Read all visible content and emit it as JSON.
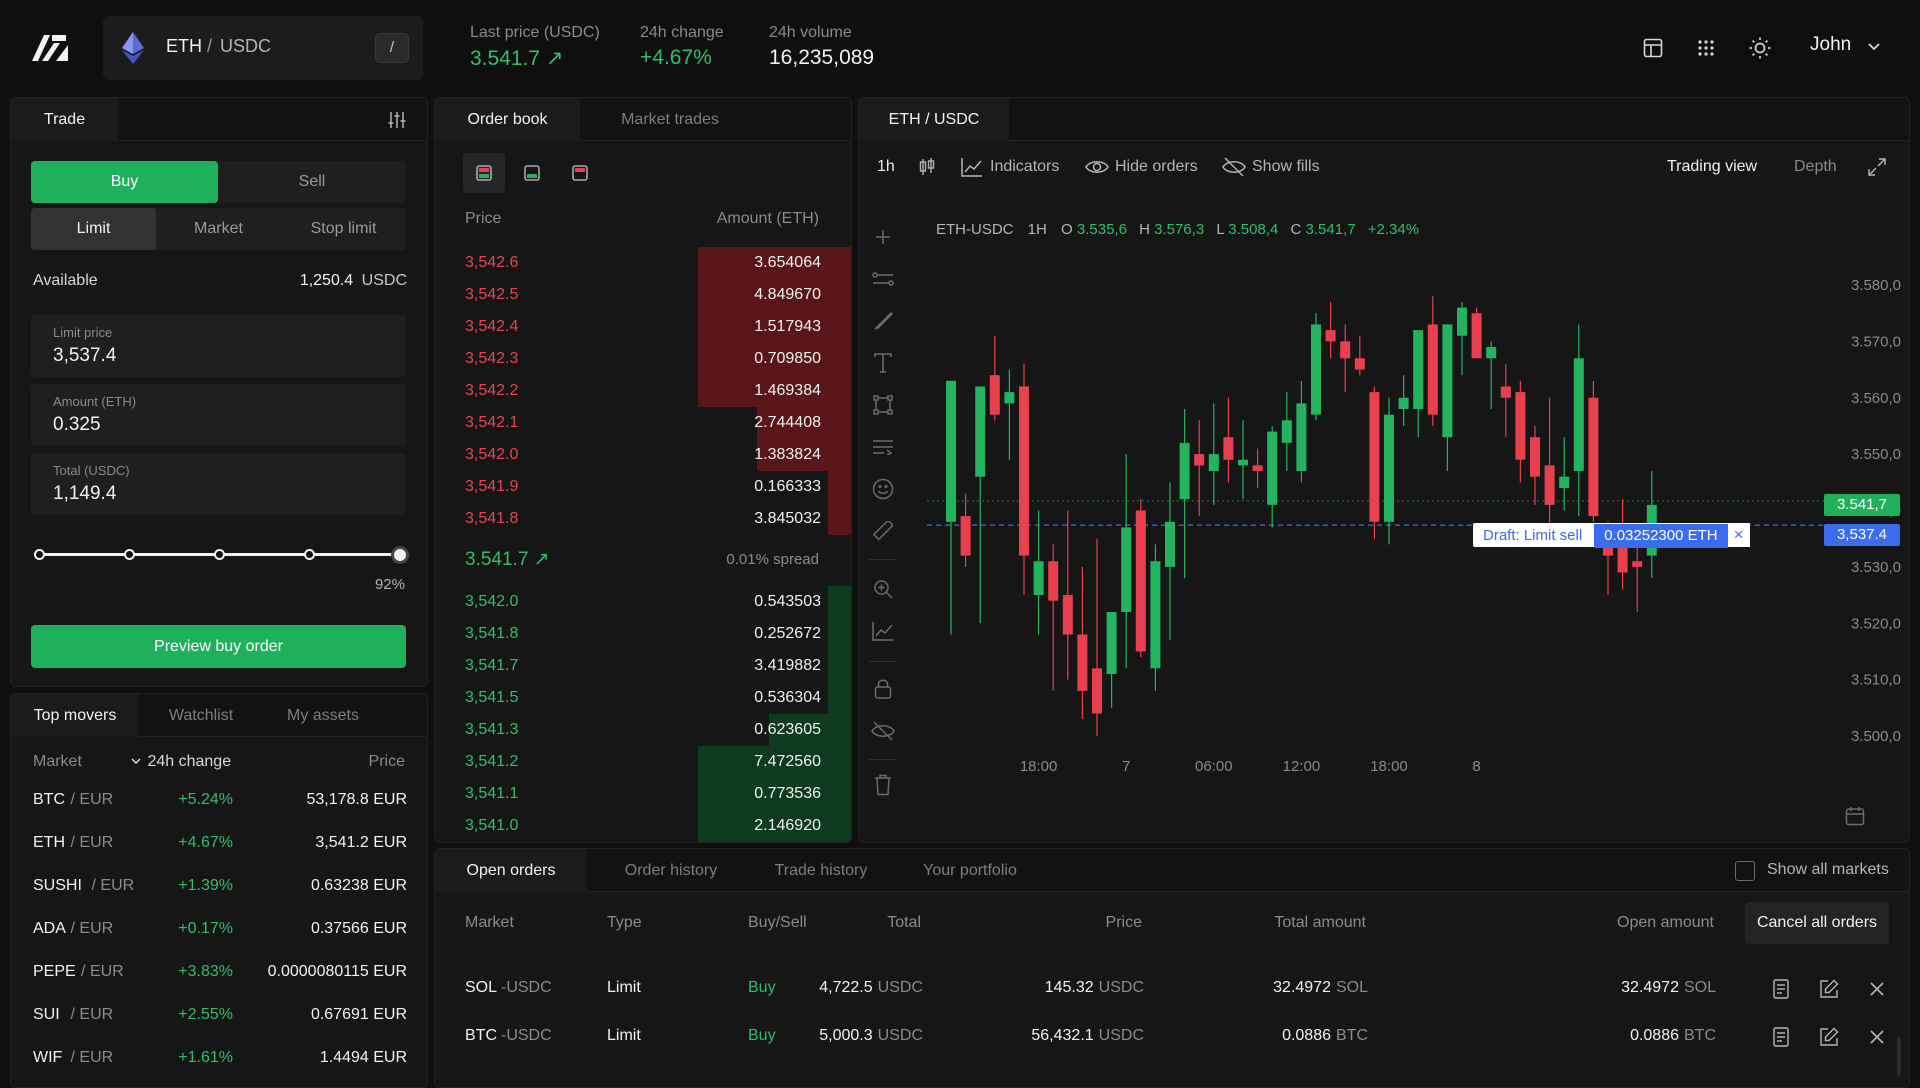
{
  "header": {
    "pair_base": "ETH",
    "pair_sep": "/",
    "pair_quote": "USDC",
    "search_key": "/",
    "stats": [
      {
        "label": "Last price (USDC)",
        "value": "3.541.7 ↗"
      },
      {
        "label": "24h change",
        "value": "+4.67%"
      },
      {
        "label": "24h volume",
        "value": "16,235,089"
      }
    ],
    "user": "John"
  },
  "trade": {
    "tab": "Trade",
    "buy": "Buy",
    "sell": "Sell",
    "order_types": [
      "Limit",
      "Market",
      "Stop limit"
    ],
    "available_label": "Available",
    "available_value": "1,250.4",
    "available_unit": "USDC",
    "limit_price_label": "Limit price",
    "limit_price": "3,537.4",
    "amount_label": "Amount (ETH)",
    "amount": "0.325",
    "total_label": "Total (USDC)",
    "total": "1,149.4",
    "slider_fraction": 0.92,
    "slider_text": "92%",
    "preview_button": "Preview buy order"
  },
  "movers": {
    "tabs": [
      "Top movers",
      "Watchlist",
      "My assets"
    ],
    "col_market": "Market",
    "col_change": "24h change",
    "col_price": "Price",
    "rows": [
      {
        "base": "BTC",
        "quote": "/ EUR",
        "change": "+5.24%",
        "price": "53,178.8 EUR"
      },
      {
        "base": "ETH",
        "quote": "/ EUR",
        "change": "+4.67%",
        "price": "3,541.2 EUR"
      },
      {
        "base": "SUSHI",
        "quote": "/ EUR",
        "change": "+1.39%",
        "price": "0.63238 EUR"
      },
      {
        "base": "ADA",
        "quote": "/ EUR",
        "change": "+0.17%",
        "price": "0.37566 EUR"
      },
      {
        "base": "PEPE",
        "quote": "/ EUR",
        "change": "+3.83%",
        "price": "0.0000080115 EUR"
      },
      {
        "base": "SUI",
        "quote": "/ EUR",
        "change": "+2.55%",
        "price": "0.67691 EUR"
      },
      {
        "base": "WIF",
        "quote": "/ EUR",
        "change": "+1.61%",
        "price": "1.4494 EUR"
      }
    ]
  },
  "orderbook": {
    "tabs": [
      "Order book",
      "Market trades"
    ],
    "col_price": "Price",
    "col_amount": "Amount (ETH)",
    "asks": [
      {
        "price": "3,542.6",
        "amount": "3.654064",
        "depth": 0.37
      },
      {
        "price": "3,542.5",
        "amount": "4.849670",
        "depth": 0.37
      },
      {
        "price": "3,542.4",
        "amount": "1.517943",
        "depth": 0.37
      },
      {
        "price": "3,542.3",
        "amount": "0.709850",
        "depth": 0.37
      },
      {
        "price": "3,542.2",
        "amount": "1.469384",
        "depth": 0.37
      },
      {
        "price": "3,542.1",
        "amount": "2.744408",
        "depth": 0.23
      },
      {
        "price": "3,542.0",
        "amount": "1.383824",
        "depth": 0.23
      },
      {
        "price": "3,541.9",
        "amount": "0.166333",
        "depth": 0.06
      },
      {
        "price": "3,541.8",
        "amount": "3.845032",
        "depth": 0.06
      }
    ],
    "mid_price": "3.541.7 ↗",
    "spread": "0.01% spread",
    "bids": [
      {
        "price": "3,542.0",
        "amount": "0.543503",
        "depth": 0.06
      },
      {
        "price": "3,541.8",
        "amount": "0.252672",
        "depth": 0.06
      },
      {
        "price": "3,541.7",
        "amount": "3.419882",
        "depth": 0.06
      },
      {
        "price": "3,541.5",
        "amount": "0.536304",
        "depth": 0.06
      },
      {
        "price": "3,541.3",
        "amount": "0.623605",
        "depth": 0.2
      },
      {
        "price": "3,541.2",
        "amount": "7.472560",
        "depth": 0.37
      },
      {
        "price": "3,541.1",
        "amount": "0.773536",
        "depth": 0.37
      },
      {
        "price": "3,541.0",
        "amount": "2.146920",
        "depth": 0.37
      }
    ]
  },
  "chart": {
    "tab": "ETH / USDC",
    "interval": "1h",
    "indicators": "Indicators",
    "hide_orders": "Hide orders",
    "show_fills": "Show fills",
    "trading_view": "Trading view",
    "depth": "Depth",
    "legend_pair": "ETH-USDC",
    "legend_tf": "1H",
    "legend_o_lbl": "O",
    "legend_o": "3.535,6",
    "legend_h_lbl": "H",
    "legend_h": "3.576,3",
    "legend_l_lbl": "L",
    "legend_l": "3.508,4",
    "legend_c_lbl": "C",
    "legend_c": "3.541,7",
    "legend_chg": "+2.34%",
    "last_price_tag": "3.541,7",
    "limit_price_tag": "3,537.4",
    "draft_label": "Draft: Limit sell",
    "draft_amount": "0.03252300 ETH",
    "draft_close": "×"
  },
  "chart_data": {
    "type": "candlestick",
    "title": "",
    "ylim": [
      3500,
      3580
    ],
    "y_ticks": [
      "3.580,0",
      "3.570,0",
      "3.560,0",
      "3.550,0",
      "3.540,0",
      "3.530,0",
      "3.520,0",
      "3.510,0",
      "3.500,0"
    ],
    "y_tick_values": [
      3580,
      3570,
      3560,
      3550,
      3540,
      3530,
      3520,
      3510,
      3500
    ],
    "x_ticks": [
      "18:00",
      "7",
      "06:00",
      "12:00",
      "18:00",
      "8"
    ],
    "x_tick_index": [
      6,
      12,
      18,
      24,
      30,
      36
    ],
    "last_price": 3541.7,
    "limit_price": 3537.4,
    "candles": [
      [
        3538,
        3562,
        3518,
        3563,
        "up"
      ],
      [
        3539,
        3543,
        3530,
        3532,
        "down"
      ],
      [
        3546,
        3555,
        3520,
        3562,
        "up"
      ],
      [
        3564,
        3571,
        3556,
        3557,
        "down"
      ],
      [
        3559,
        3565,
        3549,
        3561,
        "up"
      ],
      [
        3562,
        3566,
        3525,
        3532,
        "down"
      ],
      [
        3525,
        3540,
        3518,
        3531,
        "up"
      ],
      [
        3531,
        3534,
        3508,
        3524,
        "down"
      ],
      [
        3525,
        3540,
        3510,
        3518,
        "down"
      ],
      [
        3518,
        3530,
        3503,
        3508,
        "down"
      ],
      [
        3512,
        3535,
        3500,
        3504,
        "down"
      ],
      [
        3511,
        3522,
        3505,
        3522,
        "up"
      ],
      [
        3522,
        3550,
        3512,
        3537,
        "up"
      ],
      [
        3540,
        3542,
        3514,
        3515,
        "down"
      ],
      [
        3512,
        3534,
        3508,
        3531,
        "up"
      ],
      [
        3530,
        3545,
        3517,
        3538,
        "up"
      ],
      [
        3542,
        3558,
        3528,
        3552,
        "up"
      ],
      [
        3550,
        3556,
        3539,
        3548,
        "down"
      ],
      [
        3547,
        3559,
        3541,
        3550,
        "up"
      ],
      [
        3553,
        3560,
        3545,
        3549,
        "down"
      ],
      [
        3548,
        3556,
        3542,
        3549,
        "up"
      ],
      [
        3548,
        3551,
        3544,
        3547,
        "down"
      ],
      [
        3541,
        3555,
        3537,
        3554,
        "up"
      ],
      [
        3552,
        3561,
        3547,
        3556,
        "up"
      ],
      [
        3547,
        3563,
        3545,
        3559,
        "up"
      ],
      [
        3557,
        3575,
        3556,
        3573,
        "up"
      ],
      [
        3572,
        3577,
        3567,
        3570,
        "down"
      ],
      [
        3570,
        3573,
        3561,
        3567,
        "down"
      ],
      [
        3567,
        3571,
        3564,
        3565,
        "down"
      ],
      [
        3561,
        3562,
        3535,
        3538,
        "down"
      ],
      [
        3538,
        3560,
        3534,
        3557,
        "up"
      ],
      [
        3560,
        3564,
        3555,
        3558,
        "up"
      ],
      [
        3558,
        3571,
        3553,
        3572,
        "up"
      ],
      [
        3573,
        3578,
        3555,
        3557,
        "down"
      ],
      [
        3553,
        3566,
        3547,
        3573,
        "up"
      ],
      [
        3571,
        3577,
        3564,
        3576,
        "up"
      ],
      [
        3575,
        3576,
        3568,
        3567,
        "down"
      ],
      [
        3567,
        3570,
        3558,
        3569,
        "up"
      ],
      [
        3562,
        3566,
        3553,
        3560,
        "down"
      ],
      [
        3561,
        3563,
        3545,
        3549,
        "down"
      ],
      [
        3553,
        3555,
        3541,
        3546,
        "down"
      ],
      [
        3548,
        3560,
        3535,
        3541,
        "down"
      ],
      [
        3546,
        3553,
        3540,
        3544,
        "up"
      ],
      [
        3547,
        3573,
        3539,
        3567,
        "up"
      ],
      [
        3560,
        3563,
        3538,
        3539,
        "down"
      ],
      [
        3537,
        3538,
        3525,
        3532,
        "down"
      ],
      [
        3535,
        3542,
        3526,
        3529,
        "down"
      ],
      [
        3531,
        3534,
        3522,
        3530,
        "down"
      ],
      [
        3532,
        3547,
        3528,
        3541,
        "up"
      ]
    ],
    "candles_format": [
      "open",
      "high",
      "low",
      "close",
      "direction"
    ]
  },
  "orders": {
    "tabs": [
      "Open orders",
      "Order history",
      "Trade history",
      "Your portfolio"
    ],
    "show_all": "Show all markets",
    "cols": [
      "Market",
      "Type",
      "Buy/Sell",
      "Total",
      "Price",
      "Total amount",
      "Open amount"
    ],
    "cancel_all": "Cancel all orders",
    "rows": [
      {
        "base": "SOL",
        "quote": "-USDC",
        "type": "Limit",
        "side": "Buy",
        "total": "4,722.5",
        "total_unit": "USDC",
        "price": "145.32",
        "price_unit": "USDC",
        "tamount": "32.4972",
        "tamount_unit": "SOL",
        "oamount": "32.4972",
        "oamount_unit": "SOL"
      },
      {
        "base": "BTC",
        "quote": "-USDC",
        "type": "Limit",
        "side": "Buy",
        "total": "5,000.3",
        "total_unit": "USDC",
        "price": "56,432.1",
        "price_unit": "USDC",
        "tamount": "0.0886",
        "tamount_unit": "BTC",
        "oamount": "0.0886",
        "oamount_unit": "BTC"
      }
    ]
  },
  "colors": {
    "up": "#24b460",
    "down": "#e8404e",
    "accent_blue": "#3b6cf0",
    "buy_green": "#1fb05c"
  },
  "icons": [
    "logo-icon",
    "eth-icon",
    "layout-icon",
    "grid-icon",
    "sun-icon",
    "chevron-down-icon",
    "sliders-icon",
    "candles-icon",
    "indicators-icon",
    "eye-icon",
    "eye-off-icon",
    "expand-icon",
    "crosshair-icon",
    "trendline-icon",
    "brush-icon",
    "text-icon",
    "shapes-icon",
    "fib-icon",
    "emoji-icon",
    "ruler-icon",
    "zoom-icon",
    "chart-icon",
    "lock-icon",
    "hide-icon",
    "trash-icon",
    "calendar-icon",
    "note-icon",
    "edit-icon",
    "close-icon"
  ]
}
